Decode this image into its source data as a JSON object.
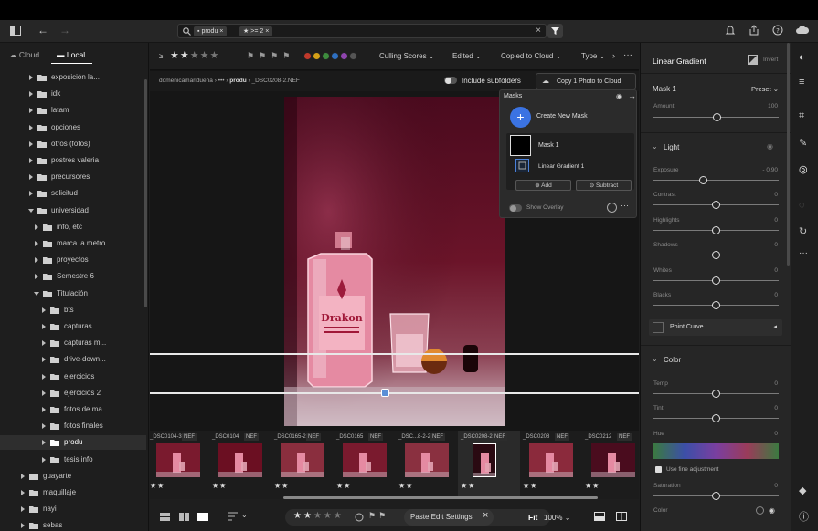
{
  "topbar": {
    "search_tag": "produ",
    "rating_tag": ">= 2"
  },
  "sidebar": {
    "tab_cloud": "Cloud",
    "tab_local": "Local",
    "items": [
      {
        "label": "exposición la...",
        "level": 1
      },
      {
        "label": "idk",
        "level": 1
      },
      {
        "label": "latam",
        "level": 1
      },
      {
        "label": "opciones",
        "level": 1
      },
      {
        "label": "otros (fotos)",
        "level": 1
      },
      {
        "label": "postres valeria",
        "level": 1
      },
      {
        "label": "precursores",
        "level": 1
      },
      {
        "label": "solicitud",
        "level": 1
      },
      {
        "label": "universidad",
        "level": 1,
        "open": true
      },
      {
        "label": "info, etc",
        "level": 2
      },
      {
        "label": "marca la metro",
        "level": 2
      },
      {
        "label": "proyectos",
        "level": 2
      },
      {
        "label": "Semestre 6",
        "level": 2
      },
      {
        "label": "Titulación",
        "level": 2,
        "open": true
      },
      {
        "label": "bts",
        "level": 3
      },
      {
        "label": "capturas",
        "level": 3
      },
      {
        "label": "capturas m...",
        "level": 3
      },
      {
        "label": "drive-down...",
        "level": 3
      },
      {
        "label": "ejercicios",
        "level": 3
      },
      {
        "label": "ejercicios 2",
        "level": 3
      },
      {
        "label": "fotos de ma...",
        "level": 3
      },
      {
        "label": "fotos finales",
        "level": 3
      },
      {
        "label": "produ",
        "level": 3,
        "selected": true
      },
      {
        "label": "tesis info",
        "level": 3
      },
      {
        "label": "guayarte",
        "level": 0
      },
      {
        "label": "maquillaje",
        "level": 0
      },
      {
        "label": "nayi",
        "level": 0
      },
      {
        "label": "sebas",
        "level": 0
      }
    ]
  },
  "filter": {
    "rating_op": "≥",
    "culling": "Culling Scores",
    "edited": "Edited",
    "copied": "Copied to Cloud",
    "type": "Type",
    "colors": [
      "#c0392b",
      "#d4a017",
      "#3d8b3d",
      "#2e6fc0",
      "#8e44ad",
      "#555555"
    ]
  },
  "path": {
    "root": "domenicamariduena",
    "dots": "•••",
    "folder": "produ",
    "file": "_DSC0208-2.NEF",
    "subfolders": "Include subfolders",
    "copy": "Copy 1 Photo to Cloud"
  },
  "masks": {
    "title": "Masks",
    "create": "Create New Mask",
    "mask1": "Mask 1",
    "gradient": "Linear Gradient 1",
    "add": "Add",
    "subtract": "Subtract",
    "overlay": "Show Overlay"
  },
  "photo": {
    "brand": "Drakon"
  },
  "film": [
    {
      "name": "_DSC0104-3",
      "nef": "NEF",
      "stars": "★★"
    },
    {
      "name": "_DSC0104",
      "nef": "NEF",
      "stars": "★★"
    },
    {
      "name": "_DSC0165-2",
      "nef": "NEF",
      "stars": "★★"
    },
    {
      "name": "_DSC0165",
      "nef": "NEF",
      "stars": "★★"
    },
    {
      "name": "_DSC...8-2-2",
      "nef": "NEF",
      "stars": "★★"
    },
    {
      "name": "_DSC0208-2",
      "nef": "NEF",
      "stars": "★★"
    },
    {
      "name": "_DSC0208",
      "nef": "NEF",
      "stars": "★★"
    },
    {
      "name": "_DSC0212",
      "nef": "NEF",
      "stars": "★★"
    }
  ],
  "bottom": {
    "paste": "Paste Edit Settings",
    "fit": "Fit",
    "zoom": "100%"
  },
  "panel": {
    "title": "Linear Gradient",
    "invert": "Invert",
    "mask": "Mask 1",
    "preset": "Preset",
    "amount_label": "Amount",
    "amount_value": "100",
    "light": "Light",
    "point_curve": "Point Curve",
    "color": "Color",
    "fine": "Use fine adjustment",
    "color_label": "Color",
    "light_sliders": [
      {
        "label": "Exposure",
        "value": "- 0,90",
        "pos": 0.4
      },
      {
        "label": "Contrast",
        "value": "0",
        "pos": 0.5
      },
      {
        "label": "Highlights",
        "value": "0",
        "pos": 0.5
      },
      {
        "label": "Shadows",
        "value": "0",
        "pos": 0.5
      },
      {
        "label": "Whites",
        "value": "0",
        "pos": 0.5
      },
      {
        "label": "Blacks",
        "value": "0",
        "pos": 0.5
      }
    ],
    "color_sliders": [
      {
        "label": "Temp",
        "value": "0",
        "pos": 0.5
      },
      {
        "label": "Tint",
        "value": "0",
        "pos": 0.5
      },
      {
        "label": "Hue",
        "value": "0",
        "pos": 0.5
      },
      {
        "label": "Saturation",
        "value": "0",
        "pos": 0.5
      }
    ]
  }
}
